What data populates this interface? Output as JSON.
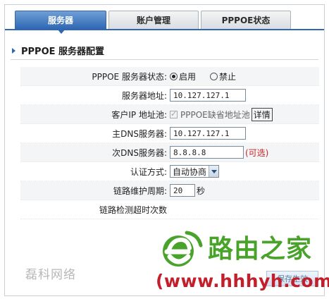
{
  "tabs": [
    {
      "label": "服务器",
      "active": true
    },
    {
      "label": "账户管理",
      "active": false
    },
    {
      "label": "PPPOE状态",
      "active": false
    }
  ],
  "section_title": "PPPOE 服务器配置",
  "form": {
    "status": {
      "label": "PPPOE 服务器状态:",
      "options": [
        "启用",
        "禁止"
      ],
      "selected": "启用"
    },
    "server_addr": {
      "label": "服务器地址:",
      "value": "10.127.127.1"
    },
    "client_pool": {
      "label": "客户IP 地址池:",
      "checkbox_label": "PPPOE缺省地址池",
      "checked": true,
      "detail": "详情"
    },
    "primary_dns": {
      "label": "主DNS服务器:",
      "value": "10.127.127.1"
    },
    "secondary_dns": {
      "label": "次DNS服务器:",
      "value": "8.8.8.8",
      "hint": "(可选)"
    },
    "auth": {
      "label": "认证方式:",
      "value": "自动协商"
    },
    "link_period": {
      "label": "链路维护周期:",
      "value": "20",
      "unit": "秒"
    },
    "link_timeout": {
      "label": "链路检测超时次数"
    }
  },
  "save_button": "保存生效",
  "watermarks": {
    "left": "磊科网络",
    "brand": "路由之家",
    "url": "(www.hhhyh.com)"
  },
  "colors": {
    "accent": "#2f67b3",
    "brand_green": "#49a32b",
    "brand_red": "#c21f2a",
    "hint_red": "#cc2222"
  }
}
